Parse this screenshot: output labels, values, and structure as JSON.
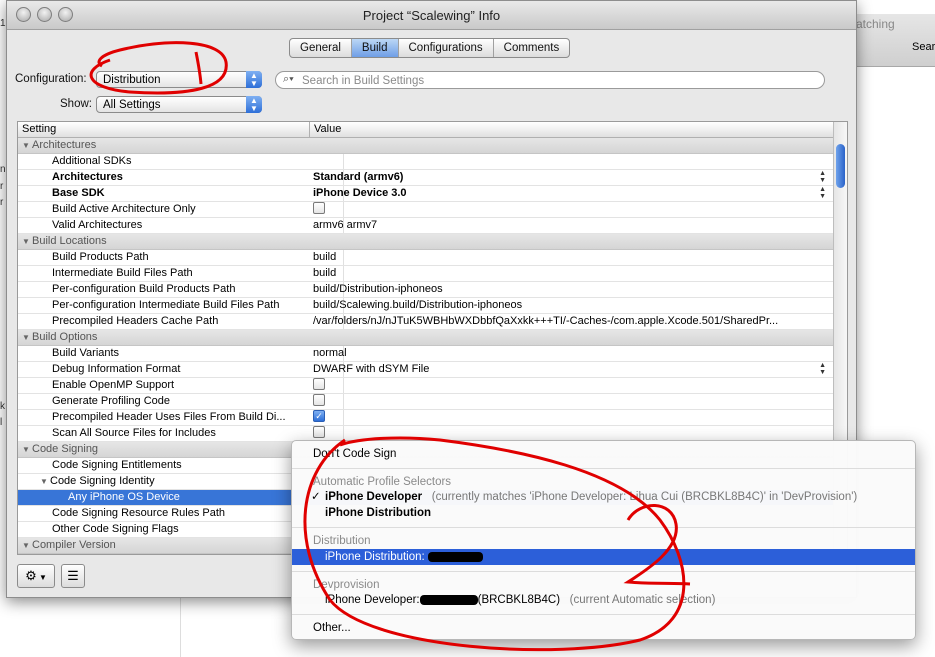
{
  "background": {
    "search_text": "atching",
    "search_label": "Sear",
    "left_glyphs": [
      "1",
      "n",
      "r",
      "r",
      "k",
      "l"
    ]
  },
  "window": {
    "title": "Project “Scalewing” Info",
    "tabs": [
      {
        "label": "General",
        "active": false
      },
      {
        "label": "Build",
        "active": true
      },
      {
        "label": "Configurations",
        "active": false
      },
      {
        "label": "Comments",
        "active": false
      }
    ],
    "configuration_label": "Configuration:",
    "configuration_value": "Distribution",
    "show_label": "Show:",
    "show_value": "All Settings",
    "search_placeholder": "Search in Build Settings"
  },
  "table": {
    "col_setting": "Setting",
    "col_value": "Value",
    "rows": [
      {
        "type": "group",
        "setting": "Architectures"
      },
      {
        "setting": "Additional SDKs",
        "value": ""
      },
      {
        "setting": "Architectures",
        "value": "Standard (armv6)",
        "bold": true,
        "stepper": true
      },
      {
        "setting": "Base SDK",
        "value": "iPhone Device 3.0",
        "bold": true,
        "stepper": true
      },
      {
        "setting": "Build Active Architecture Only",
        "checkbox": "off"
      },
      {
        "setting": "Valid Architectures",
        "value": "armv6 armv7"
      },
      {
        "type": "group",
        "setting": "Build Locations"
      },
      {
        "setting": "Build Products Path",
        "value": "build"
      },
      {
        "setting": "Intermediate Build Files Path",
        "value": "build"
      },
      {
        "setting": "Per-configuration Build Products Path",
        "value": "build/Distribution-iphoneos"
      },
      {
        "setting": "Per-configuration Intermediate Build Files Path",
        "value": "build/Scalewing.build/Distribution-iphoneos"
      },
      {
        "setting": "Precompiled Headers Cache Path",
        "value": "/var/folders/nJ/nJTuK5WBHbWXDbbfQaXxkk+++TI/-Caches-/com.apple.Xcode.501/SharedPr..."
      },
      {
        "type": "group",
        "setting": "Build Options"
      },
      {
        "setting": "Build Variants",
        "value": "normal"
      },
      {
        "setting": "Debug Information Format",
        "value": "DWARF with dSYM File",
        "stepper": true
      },
      {
        "setting": "Enable OpenMP Support",
        "checkbox": "off"
      },
      {
        "setting": "Generate Profiling Code",
        "checkbox": "off"
      },
      {
        "setting": "Precompiled Header Uses Files From Build Di...",
        "checkbox": "on"
      },
      {
        "setting": "Scan All Source Files for Includes",
        "checkbox": "off"
      },
      {
        "type": "group",
        "setting": "Code Signing"
      },
      {
        "setting": "Code Signing Entitlements",
        "value": ""
      },
      {
        "setting": "Code Signing Identity",
        "value": "",
        "disclosure": true
      },
      {
        "setting": "Any iPhone OS Device",
        "value": "",
        "selected": true,
        "indent": 2
      },
      {
        "setting": "Code Signing Resource Rules Path",
        "value": ""
      },
      {
        "setting": "Other Code Signing Flags",
        "value": ""
      },
      {
        "type": "group",
        "setting": "Compiler Version"
      }
    ]
  },
  "menu": {
    "dont_sign": "Don't Code Sign",
    "auto_header": "Automatic Profile Selectors",
    "iphone_developer": "iPhone Developer",
    "iphone_developer_note": "(currently matches 'iPhone Developer: Lihua Cui (BRCBKL8B4C)' in 'DevProvision')",
    "iphone_distribution": "iPhone Distribution",
    "distribution_header": "Distribution",
    "distribution_identity": "iPhone Distribution:",
    "devprovision_header": "Devprovision",
    "developer_identity": "iPhone Developer:",
    "developer_identity_id": "(BRCBKL8B4C)",
    "developer_identity_note": "(current Automatic selection)",
    "other": "Other..."
  },
  "colors": {
    "selection": "#3875d7",
    "menu_highlight": "#2c5fd9",
    "annotation": "#e00000"
  }
}
